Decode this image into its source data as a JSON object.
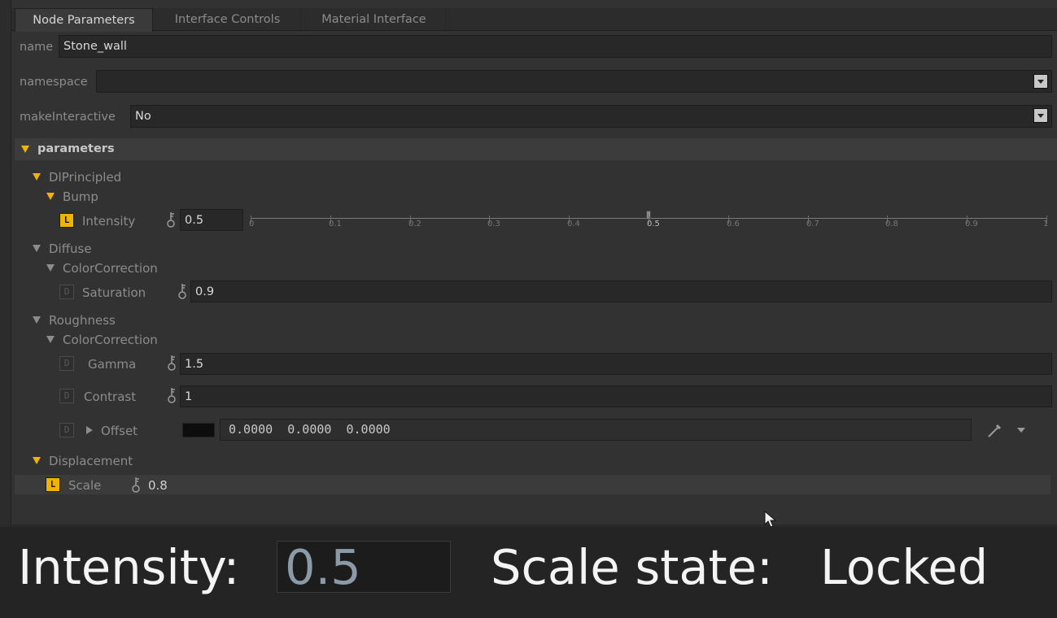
{
  "tabs": [
    "Node Parameters",
    "Interface Controls",
    "Material Interface"
  ],
  "fields": {
    "name_label": "name",
    "name_value": "Stone_wall",
    "namespace_label": "namespace",
    "namespace_value": "",
    "make_interactive_label": "makeInteractive",
    "make_interactive_value": "No"
  },
  "parameters_title": "parameters",
  "groups": {
    "principled": "DlPrincipled",
    "bump": "Bump",
    "intensity_label": "Intensity",
    "intensity_value": "0.5",
    "diffuse": "Diffuse",
    "diffuse_cc": "ColorCorrection",
    "saturation_label": "Saturation",
    "saturation_value": "0.9",
    "roughness": "Roughness",
    "roughness_cc": "ColorCorrection",
    "gamma_label": "Gamma",
    "gamma_value": "1.5",
    "contrast_label": "Contrast",
    "contrast_value": "1",
    "offset_label": "Offset",
    "offset_value": "0.0000  0.0000  0.0000",
    "displacement": "Displacement",
    "scale_label": "Scale",
    "scale_value": "0.8"
  },
  "lock_letters": {
    "locked": "L",
    "default": "D"
  },
  "slider": {
    "ticks": [
      "0",
      "0.1",
      "0.2",
      "0.3",
      "0.4",
      "0.5",
      "0.6",
      "0.7",
      "0.8",
      "0.9",
      "1"
    ],
    "value": 0.5
  },
  "status": {
    "intensity_label": "Intensity:",
    "intensity_value": "0.5",
    "scale_label": "Scale state:",
    "scale_value": "Locked"
  },
  "colors": {
    "accent": "#f0b400",
    "panel": "#323232",
    "field": "#282828"
  }
}
